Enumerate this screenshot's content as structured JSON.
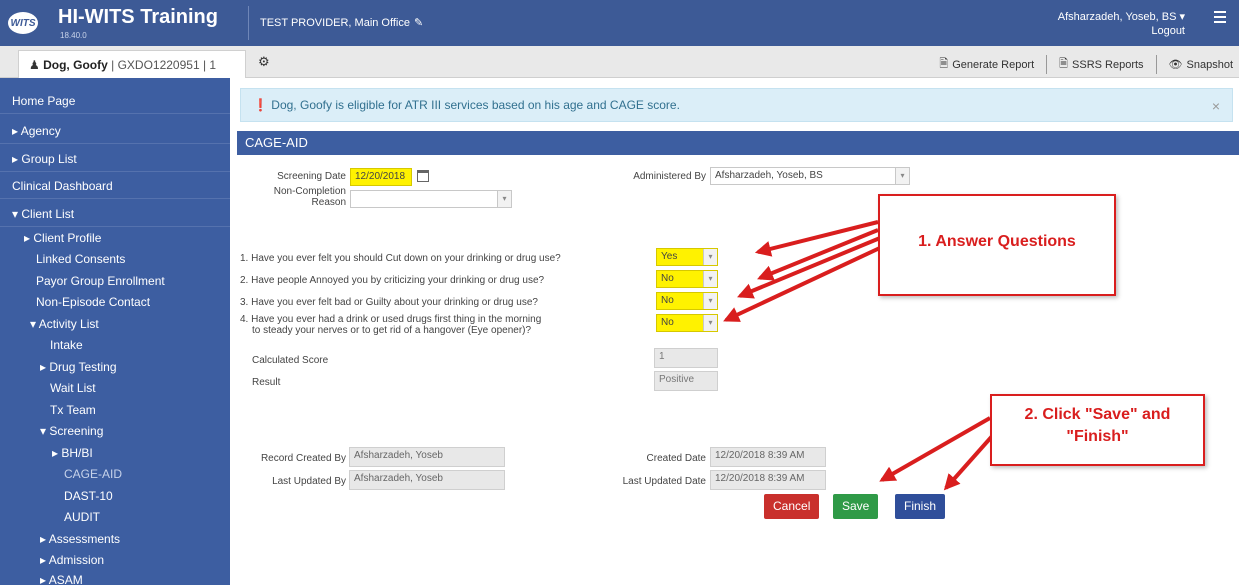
{
  "header": {
    "logo_text": "WITS",
    "title": "HI-WITS Training",
    "version": "18.40.0",
    "provider": "TEST PROVIDER, Main Office",
    "user": "Afsharzadeh, Yoseb, BS ▾",
    "logout": "Logout"
  },
  "subbar": {
    "client_name": "Dog, Goofy",
    "client_rest": " | GXDO1220951 | 1",
    "actions": [
      "Generate Report",
      "SSRS Reports",
      "Snapshot"
    ]
  },
  "sidebar": {
    "items": [
      {
        "label": "Home Page"
      },
      {
        "label": "▸ Agency"
      },
      {
        "label": "▸ Group List"
      },
      {
        "label": "Clinical Dashboard"
      },
      {
        "label": "▾ Client List"
      },
      {
        "label": "▸ Client Profile"
      },
      {
        "label": "Linked Consents"
      },
      {
        "label": "Payor Group Enrollment"
      },
      {
        "label": "Non-Episode Contact"
      },
      {
        "label": "▾ Activity List"
      },
      {
        "label": "Intake"
      },
      {
        "label": "▸ Drug Testing"
      },
      {
        "label": "Wait List"
      },
      {
        "label": "Tx Team"
      },
      {
        "label": "▾ Screening"
      },
      {
        "label": "▸ BH/BI"
      },
      {
        "label": "CAGE-AID"
      },
      {
        "label": "DAST-10"
      },
      {
        "label": "AUDIT"
      },
      {
        "label": "▸ Assessments"
      },
      {
        "label": "▸ Admission"
      },
      {
        "label": "▸ ASAM"
      }
    ]
  },
  "alert": {
    "text": "Dog, Goofy is eligible for ATR III services based on his age and CAGE score.",
    "close": "×"
  },
  "form": {
    "section_title": "CAGE-AID",
    "screening_date_label": "Screening Date",
    "screening_date": "12/20/2018",
    "non_completion_label_1": "Non-Completion",
    "non_completion_label_2": "Reason",
    "non_completion_value": "",
    "administered_by_label": "Administered By",
    "administered_by": "Afsharzadeh, Yoseb, BS",
    "questions": [
      {
        "text": "1. Have you ever felt you should Cut down on your drinking or drug use?",
        "answer": "Yes"
      },
      {
        "text": "2. Have people Annoyed you by criticizing your drinking or drug use?",
        "answer": "No"
      },
      {
        "text": "3. Have you ever felt bad or Guilty about your drinking or drug use?",
        "answer": "No"
      },
      {
        "text": "4. Have you ever had a drink or used drugs first thing in the morning",
        "text2": "to steady your nerves or to get rid of a hangover (Eye opener)?",
        "answer": "No"
      }
    ],
    "score_label": "Calculated Score",
    "score": "1",
    "result_label": "Result",
    "result": "Positive",
    "record_created_by_label": "Record Created By",
    "record_created_by": "Afsharzadeh, Yoseb",
    "last_updated_by_label": "Last Updated By",
    "last_updated_by": "Afsharzadeh, Yoseb",
    "created_date_label": "Created Date",
    "created_date": "12/20/2018 8:39 AM",
    "last_updated_date_label": "Last Updated Date",
    "last_updated_date": "12/20/2018 8:39 AM"
  },
  "buttons": {
    "cancel": "Cancel",
    "save": "Save",
    "finish": "Finish"
  },
  "callouts": {
    "answer": "1. Answer Questions",
    "save_finish_1": "2. Click \"Save\" and",
    "save_finish_2": "\"Finish\""
  },
  "colors": {
    "brand": "#3d5a96",
    "sidebar": "#3d5ea1",
    "highlight": "#fff200",
    "annotation": "#d91e1e"
  }
}
